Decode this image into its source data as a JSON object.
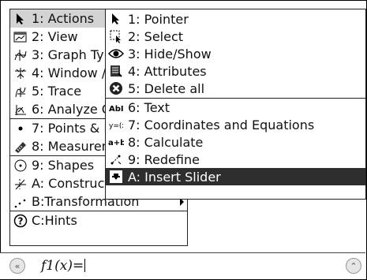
{
  "main_menu": {
    "items": [
      {
        "label": "1: Actions",
        "icon": "pointer-icon"
      },
      {
        "label": "2: View",
        "icon": "view-icon"
      },
      {
        "label": "3: Graph Type",
        "icon": "graph-type-icon"
      },
      {
        "label": "4: Window / Zoom",
        "icon": "window-zoom-icon"
      },
      {
        "label": "5: Trace",
        "icon": "trace-icon"
      },
      {
        "label": "6: Analyze Graph",
        "icon": "analyze-icon"
      },
      {
        "label": "7: Points & Lines",
        "icon": "points-icon"
      },
      {
        "label": "8: Measurement",
        "icon": "ruler-icon"
      },
      {
        "label": "9: Shapes",
        "icon": "shapes-icon"
      },
      {
        "label": "A: Construction",
        "icon": "construction-icon"
      },
      {
        "label": "B:Transformation",
        "icon": "transformation-icon"
      },
      {
        "label": "C:Hints",
        "icon": "hints-icon"
      }
    ]
  },
  "submenu": {
    "items": [
      {
        "label": "1: Pointer",
        "icon": "pointer-icon"
      },
      {
        "label": "2: Select",
        "icon": "select-icon"
      },
      {
        "label": "3: Hide/Show",
        "icon": "eye-icon"
      },
      {
        "label": "4: Attributes",
        "icon": "attributes-icon"
      },
      {
        "label": "5: Delete all",
        "icon": "delete-icon"
      },
      {
        "label": "6: Text",
        "icon": "text-icon"
      },
      {
        "label": "7: Coordinates and Equations",
        "icon": "coordinates-icon"
      },
      {
        "label": "8: Calculate",
        "icon": "calculate-icon"
      },
      {
        "label": "9: Redefine",
        "icon": "redefine-icon"
      },
      {
        "label": "A: Insert Slider",
        "icon": "slider-icon"
      }
    ]
  },
  "entry_line": {
    "text": "f1(x)="
  }
}
